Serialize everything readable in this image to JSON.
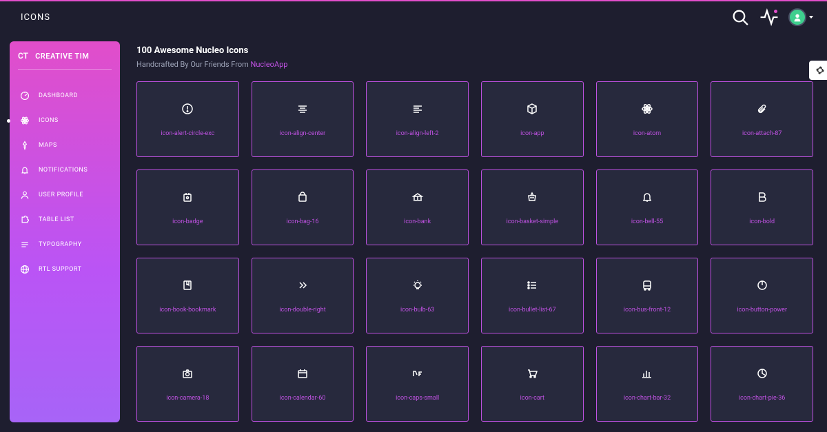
{
  "page": {
    "title": "ICONS"
  },
  "brand": {
    "short": "CT",
    "name": "CREATIVE TIM"
  },
  "sidebar": {
    "items": [
      {
        "label": "DASHBOARD",
        "icon": "dashboard-icon"
      },
      {
        "label": "ICONS",
        "icon": "atom-icon",
        "active": true
      },
      {
        "label": "MAPS",
        "icon": "pin-icon"
      },
      {
        "label": "NOTIFICATIONS",
        "icon": "bell-icon"
      },
      {
        "label": "USER PROFILE",
        "icon": "user-icon"
      },
      {
        "label": "TABLE LIST",
        "icon": "puzzle-icon"
      },
      {
        "label": "TYPOGRAPHY",
        "icon": "align-icon"
      },
      {
        "label": "RTL SUPPORT",
        "icon": "globe-icon"
      }
    ]
  },
  "header": {
    "title": "100 Awesome Nucleo Icons",
    "subtitle_prefix": "Handcrafted By Our Friends From ",
    "subtitle_link": "NucleoApp"
  },
  "icons": [
    {
      "label": "icon-alert-circle-exc",
      "glyph": "alert-circle"
    },
    {
      "label": "icon-align-center",
      "glyph": "align-center"
    },
    {
      "label": "icon-align-left-2",
      "glyph": "align-left"
    },
    {
      "label": "icon-app",
      "glyph": "cube"
    },
    {
      "label": "icon-atom",
      "glyph": "atom"
    },
    {
      "label": "icon-attach-87",
      "glyph": "paperclip"
    },
    {
      "label": "icon-badge",
      "glyph": "badge"
    },
    {
      "label": "icon-bag-16",
      "glyph": "bag"
    },
    {
      "label": "icon-bank",
      "glyph": "bank"
    },
    {
      "label": "icon-basket-simple",
      "glyph": "basket"
    },
    {
      "label": "icon-bell-55",
      "glyph": "bell"
    },
    {
      "label": "icon-bold",
      "glyph": "bold"
    },
    {
      "label": "icon-book-bookmark",
      "glyph": "book"
    },
    {
      "label": "icon-double-right",
      "glyph": "chevrons"
    },
    {
      "label": "icon-bulb-63",
      "glyph": "bulb"
    },
    {
      "label": "icon-bullet-list-67",
      "glyph": "list"
    },
    {
      "label": "icon-bus-front-12",
      "glyph": "bus"
    },
    {
      "label": "icon-button-power",
      "glyph": "power"
    },
    {
      "label": "icon-camera-18",
      "glyph": "camera"
    },
    {
      "label": "icon-calendar-60",
      "glyph": "calendar"
    },
    {
      "label": "icon-caps-small",
      "glyph": "caps"
    },
    {
      "label": "icon-cart",
      "glyph": "cart"
    },
    {
      "label": "icon-chart-bar-32",
      "glyph": "bar"
    },
    {
      "label": "icon-chart-pie-36",
      "glyph": "pie"
    }
  ]
}
